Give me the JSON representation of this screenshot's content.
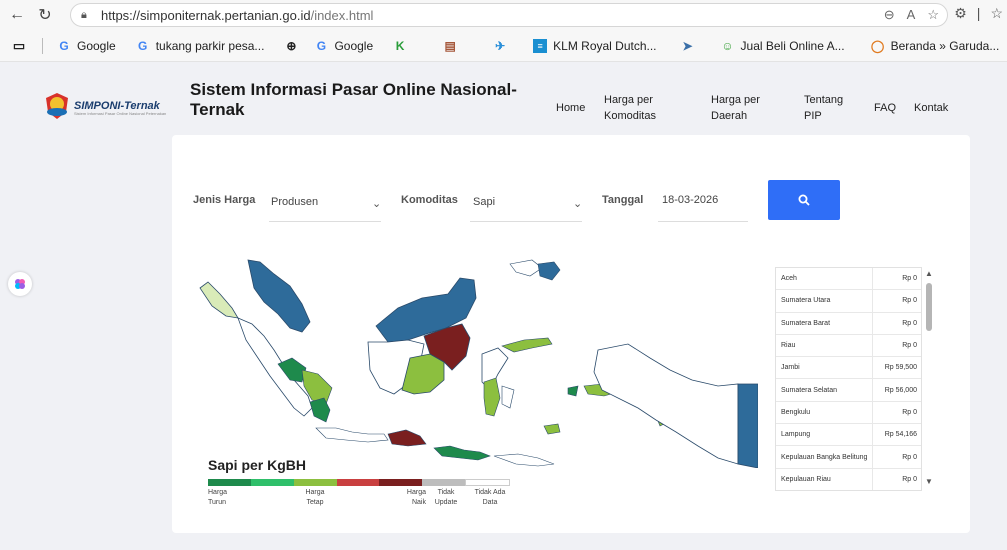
{
  "browser": {
    "url_main": "https://simponiternak.pertanian.go.id",
    "url_rest": "/index.html",
    "bookmarks": [
      {
        "label": "Google",
        "icon": "google-icon"
      },
      {
        "label": "tukang parkir pesa...",
        "icon": "google-icon"
      },
      {
        "label": "",
        "icon": "globe-icon"
      },
      {
        "label": "Google",
        "icon": "google-icon"
      },
      {
        "label": "",
        "icon": "k-icon"
      },
      {
        "label": "",
        "icon": "book-icon"
      },
      {
        "label": "",
        "icon": "bird-icon"
      },
      {
        "label": "KLM Royal Dutch...",
        "icon": "klm-icon"
      },
      {
        "label": "",
        "icon": "plane-icon"
      },
      {
        "label": "Jual Beli Online A...",
        "icon": "shop-icon"
      },
      {
        "label": "Beranda » Garuda...",
        "icon": "garuda-icon"
      }
    ]
  },
  "header": {
    "logo_text": "SIMPONI-Ternak",
    "logo_sub": "Sistem Informasi Pasar Online Nasional Peternakan",
    "title": "Sistem Informasi Pasar Online Nasional-Ternak",
    "menu": {
      "home": "Home",
      "harga_komoditas": "Harga per Komoditas",
      "harga_daerah": "Harga per Daerah",
      "tentang": "Tentang PIP",
      "faq": "FAQ",
      "kontak": "Kontak"
    }
  },
  "filters": {
    "jenis_harga_label": "Jenis Harga",
    "jenis_harga_value": "Produsen",
    "komoditas_label": "Komoditas",
    "komoditas_value": "Sapi",
    "tanggal_label": "Tanggal",
    "tanggal_value": "18-03-2026"
  },
  "legend": {
    "title": "Sapi per KgBH",
    "colors": [
      "#1e8a4c",
      "#2fbf6a",
      "#8cbf3f",
      "#c94040",
      "#7a1f1f",
      "#bdbdbd",
      "#ffffff"
    ],
    "labels": {
      "turun": "Harga Turun",
      "tetap": "Harga Tetap",
      "naik": "Harga Naik",
      "tidak_update": "Tidak Update",
      "tidak_ada": "Tidak Ada Data"
    }
  },
  "prices": [
    {
      "province": "Aceh",
      "price": "Rp 0"
    },
    {
      "province": "Sumatera Utara",
      "price": "Rp 0"
    },
    {
      "province": "Sumatera Barat",
      "price": "Rp 0"
    },
    {
      "province": "Riau",
      "price": "Rp 0"
    },
    {
      "province": "Jambi",
      "price": "Rp 59,500"
    },
    {
      "province": "Sumatera Selatan",
      "price": "Rp 56,000"
    },
    {
      "province": "Bengkulu",
      "price": "Rp 0"
    },
    {
      "province": "Lampung",
      "price": "Rp 54,166"
    },
    {
      "province": "Kepulauan Bangka Belitung",
      "price": "Rp 0"
    },
    {
      "province": "Kepulauan Riau",
      "price": "Rp 0"
    }
  ],
  "colors": {
    "accent": "#2f6ef7",
    "no_update": "#2e6b9a",
    "harga_naik": "#7a1f1f",
    "harga_tetap": "#8cbf3f",
    "harga_turun": "#1e8a4c"
  }
}
